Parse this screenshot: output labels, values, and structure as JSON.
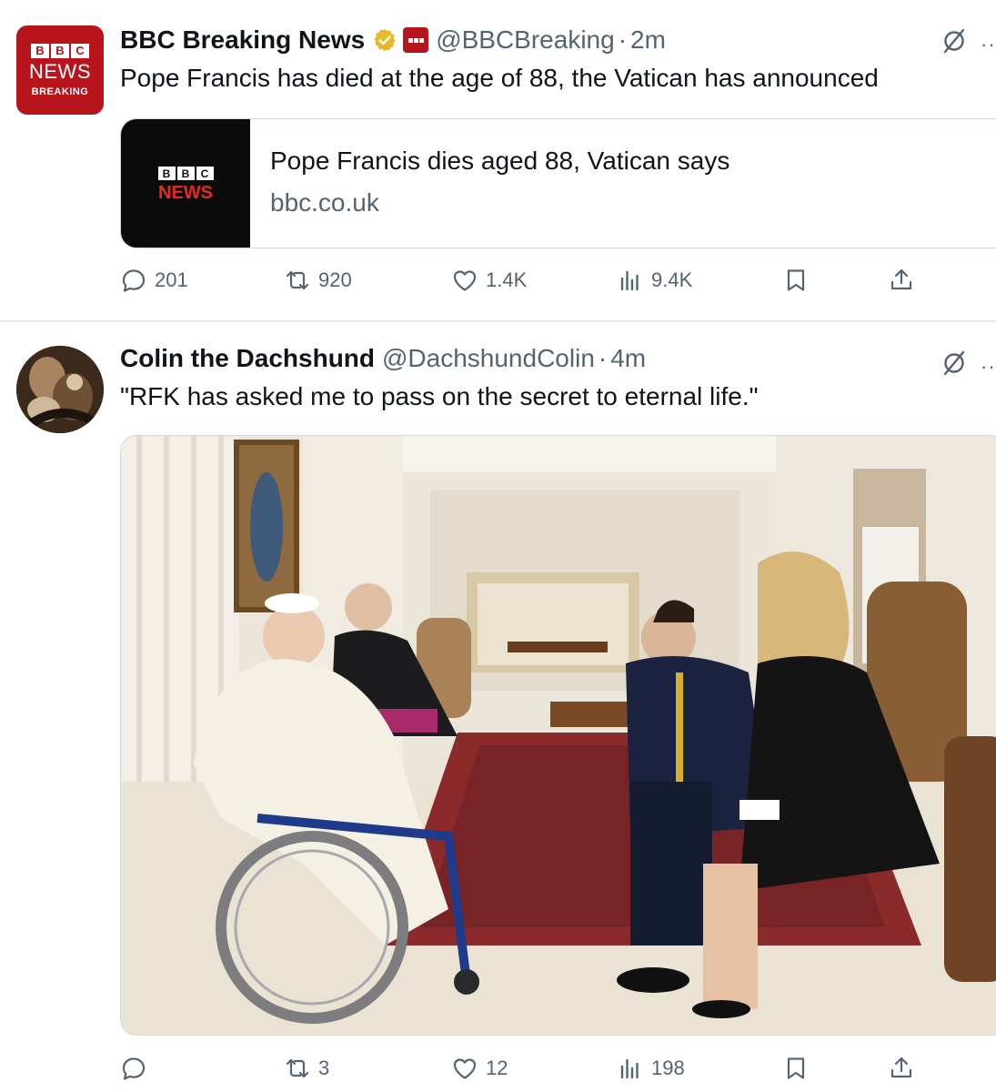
{
  "tweets": [
    {
      "author": "BBC Breaking News",
      "handle": "@BBCBreaking",
      "separator": "·",
      "time": "2m",
      "text": "Pope Francis has died at the age of 88, the Vatican has announced",
      "avatar": {
        "line1": [
          "B",
          "B",
          "C"
        ],
        "line2": "NEWS",
        "line3": "BREAKING"
      },
      "badge_icon": "verified-gold-badge-icon",
      "affiliate_icon": "bbc-news-affiliate-icon",
      "card": {
        "title": "Pope Francis dies aged 88, Vatican says",
        "domain": "bbc.co.uk",
        "thumb_blocks": [
          "B",
          "B",
          "C"
        ],
        "thumb_news": "NEWS"
      },
      "actions": {
        "replies": "201",
        "reposts": "920",
        "likes": "1.4K",
        "views": "9.4K"
      }
    },
    {
      "author": "Colin the Dachshund",
      "handle": "@DachshundColin",
      "separator": "·",
      "time": "4m",
      "text": "\"RFK has asked me to pass on the secret to eternal life.\"",
      "image": "photo-pope-meeting-in-vatican-room",
      "actions": {
        "replies": "",
        "reposts": "3",
        "likes": "12",
        "views": "198"
      }
    }
  ],
  "colors": {
    "bbc_red": "#b8141c",
    "text_primary": "#0f1419",
    "text_secondary": "#536471",
    "border": "#cfd9de",
    "verified_gold": "#e8b829"
  },
  "icons": [
    "grok-icon",
    "more-icon",
    "reply-icon",
    "repost-icon",
    "like-icon",
    "views-icon",
    "bookmark-icon",
    "share-icon"
  ]
}
